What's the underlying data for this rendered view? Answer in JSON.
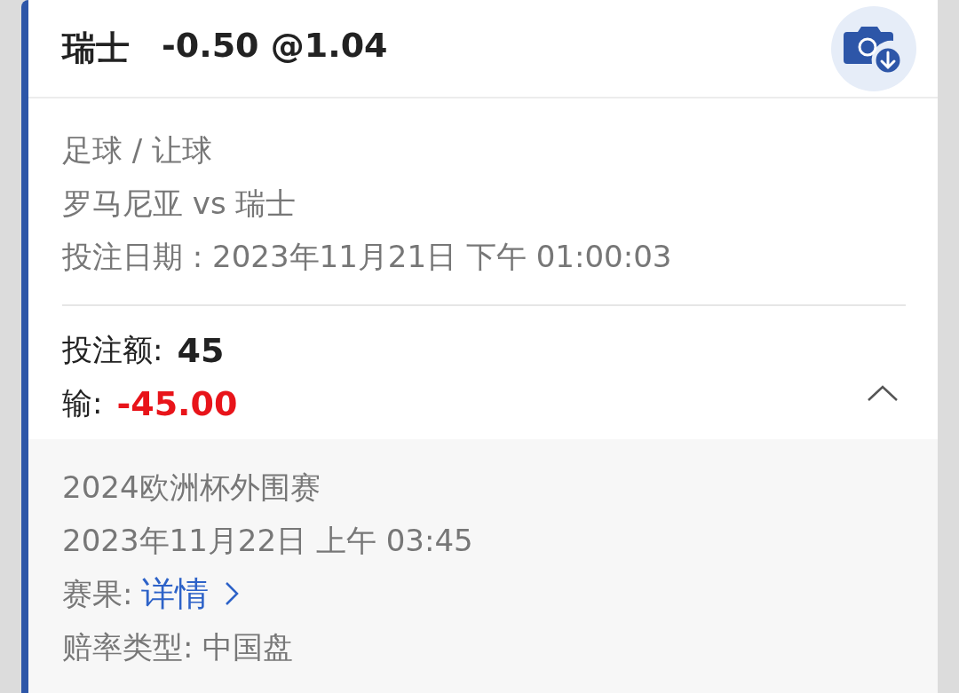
{
  "header": {
    "selection": "瑞士",
    "odds_line": "-0.50 @1.04"
  },
  "info": [
    "足球 / 让球",
    "罗马尼亚 vs 瑞士",
    "投注日期 : 2023年11月21日 下午 01:00:03"
  ],
  "stake": {
    "label": "投注额:",
    "value": "45"
  },
  "result": {
    "label": "输:",
    "value": "-45.00",
    "kind": "loss"
  },
  "details": {
    "expanded": true,
    "lines": [
      {
        "kind": "text",
        "text": "2024欧洲杯外围赛"
      },
      {
        "kind": "text",
        "text": "2023年11月22日 上午 03:45"
      },
      {
        "kind": "link",
        "label": "赛果:",
        "link": "详情"
      },
      {
        "kind": "text",
        "text": "赔率类型: 中国盘"
      }
    ]
  }
}
